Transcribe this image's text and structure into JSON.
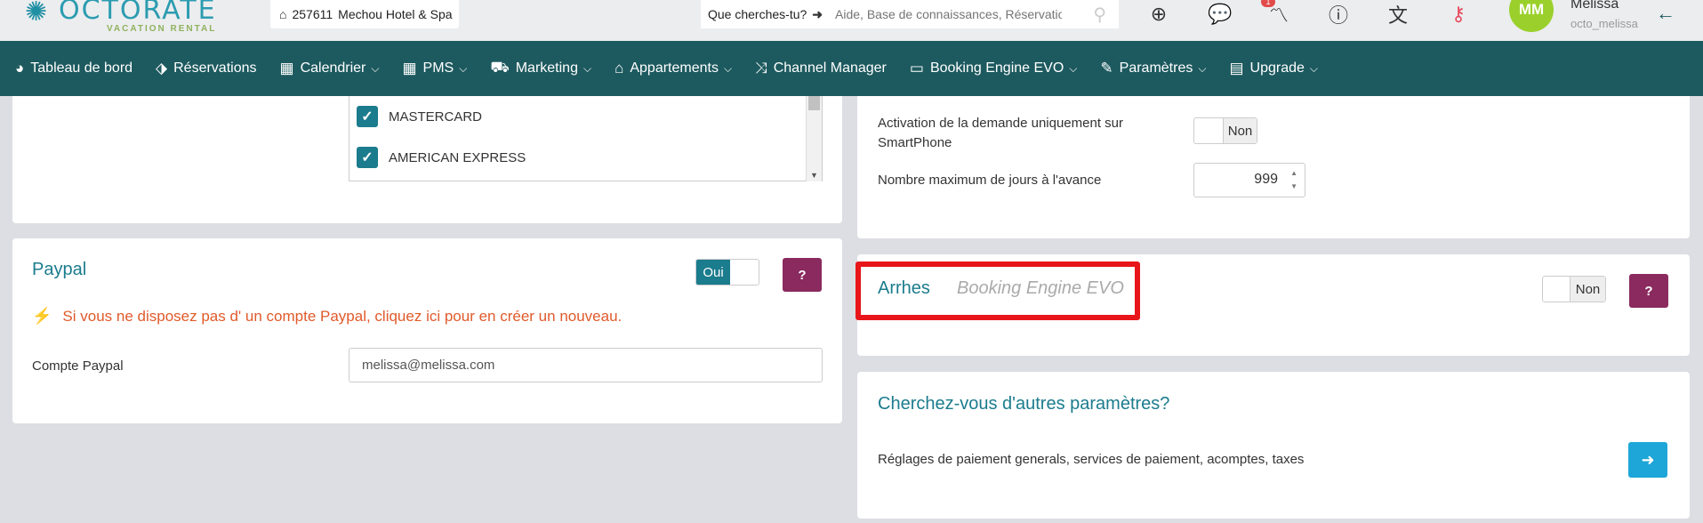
{
  "header": {
    "logo_text": "OCTORATE",
    "logo_sub": "VACATION RENTAL",
    "hotel_id": "257611",
    "hotel_name": "Mechou Hotel & Spa",
    "search_label": "Que cherches-tu?",
    "search_placeholder": "Aide, Base de connaissances, Réservatio",
    "notification_count": "1",
    "avatar_initials": "MM",
    "user_name": "Melissa",
    "user_login": "octo_melissa"
  },
  "nav": [
    {
      "label": "Tableau de bord",
      "icon": "dashboard-icon",
      "glyph": "◕",
      "dropdown": false
    },
    {
      "label": "Réservations",
      "icon": "tag-icon",
      "glyph": "⬗",
      "dropdown": false
    },
    {
      "label": "Calendrier",
      "icon": "calendar-icon",
      "glyph": "▦",
      "dropdown": true
    },
    {
      "label": "PMS",
      "icon": "grid-icon",
      "glyph": "▦",
      "dropdown": true
    },
    {
      "label": "Marketing",
      "icon": "cart-icon",
      "glyph": "⛟",
      "dropdown": true
    },
    {
      "label": "Appartements",
      "icon": "home-icon",
      "glyph": "⌂",
      "dropdown": true
    },
    {
      "label": "Channel Manager",
      "icon": "shuffle-icon",
      "glyph": "⤨",
      "dropdown": false
    },
    {
      "label": "Booking Engine EVO",
      "icon": "monitor-icon",
      "glyph": "▭",
      "dropdown": true
    },
    {
      "label": "Paramètres",
      "icon": "wrench-icon",
      "glyph": "✎",
      "dropdown": true
    },
    {
      "label": "Upgrade",
      "icon": "credit-card-icon",
      "glyph": "▤",
      "dropdown": true
    }
  ],
  "cards": {
    "items": [
      "MASTERCARD",
      "AMERICAN EXPRESS"
    ]
  },
  "paypal": {
    "title": "Paypal",
    "toggle_on": "Oui",
    "help": "?",
    "warning": "Si vous ne disposez pas d' un compte Paypal, cliquez ici pour en créer un nouveau.",
    "account_label": "Compte Paypal",
    "account_value": "melissa@melissa.com"
  },
  "request": {
    "smartphone_label_line1": "Activation de la demande uniquement sur",
    "smartphone_label_line2": "SmartPhone",
    "smartphone_toggle": "Non",
    "max_days_label": "Nombre maximum de jours à l'avance",
    "max_days_value": "999"
  },
  "arrhes": {
    "title": "Arrhes",
    "subtitle": "Booking Engine EVO",
    "toggle": "Non",
    "help": "?"
  },
  "more_settings": {
    "title": "Cherchez-vous d'autres paramètres?",
    "text": "Réglages de paiement generals, services de paiement, acomptes, taxes"
  },
  "colors": {
    "nav_bg": "#1d5a5f",
    "accent": "#1b7c8d",
    "help": "#8a2a5e",
    "warning": "#e05a2b",
    "highlight": "#e8161a",
    "arrow_btn": "#1ea6d8"
  }
}
